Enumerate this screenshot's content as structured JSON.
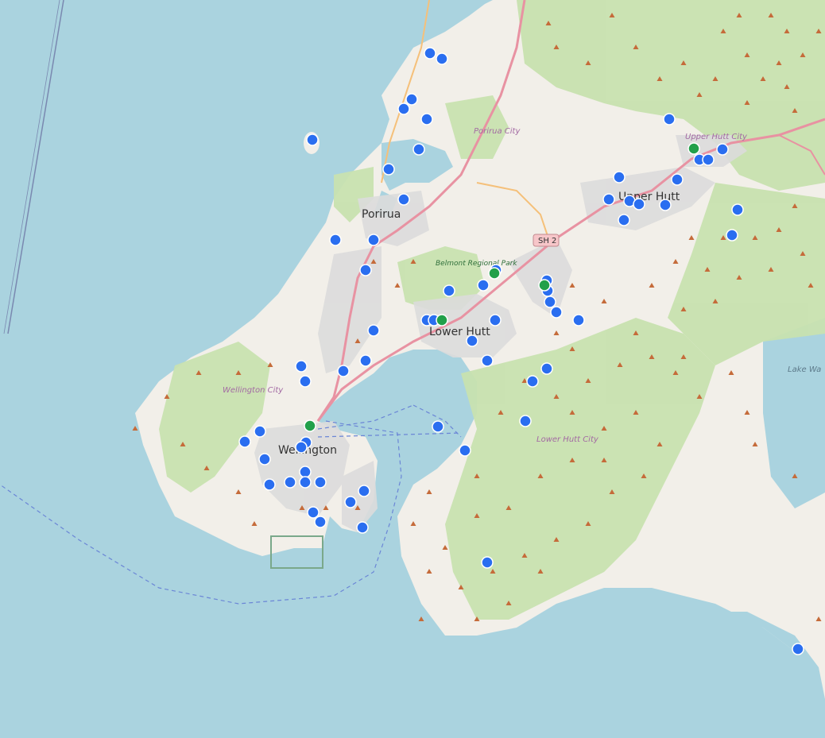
{
  "map": {
    "places": {
      "porirua": "Porirua",
      "porirua_city": "Porirua City",
      "upper_hutt": "Upper Hutt",
      "upper_hutt_city": "Upper Hutt City",
      "lower_hutt": "Lower Hutt",
      "lower_hutt_city": "Lower Hutt City",
      "wellington": "Wellington",
      "wellington_city": "Wellington City",
      "belmont_park": "Belmont Regional Park",
      "lake": "Lake Wa"
    },
    "road_shield": "SH 2",
    "colors": {
      "water": "#aad3df",
      "land": "#f2efe9",
      "park": "#c8e2b0",
      "urban": "#dcdcdc",
      "marker_blue": "#2a6ef0",
      "marker_green": "#22a04a",
      "road_primary": "#e892a2",
      "peak": "#c56b3a"
    },
    "marker_counts": {
      "blue": 70,
      "green": 5
    }
  }
}
